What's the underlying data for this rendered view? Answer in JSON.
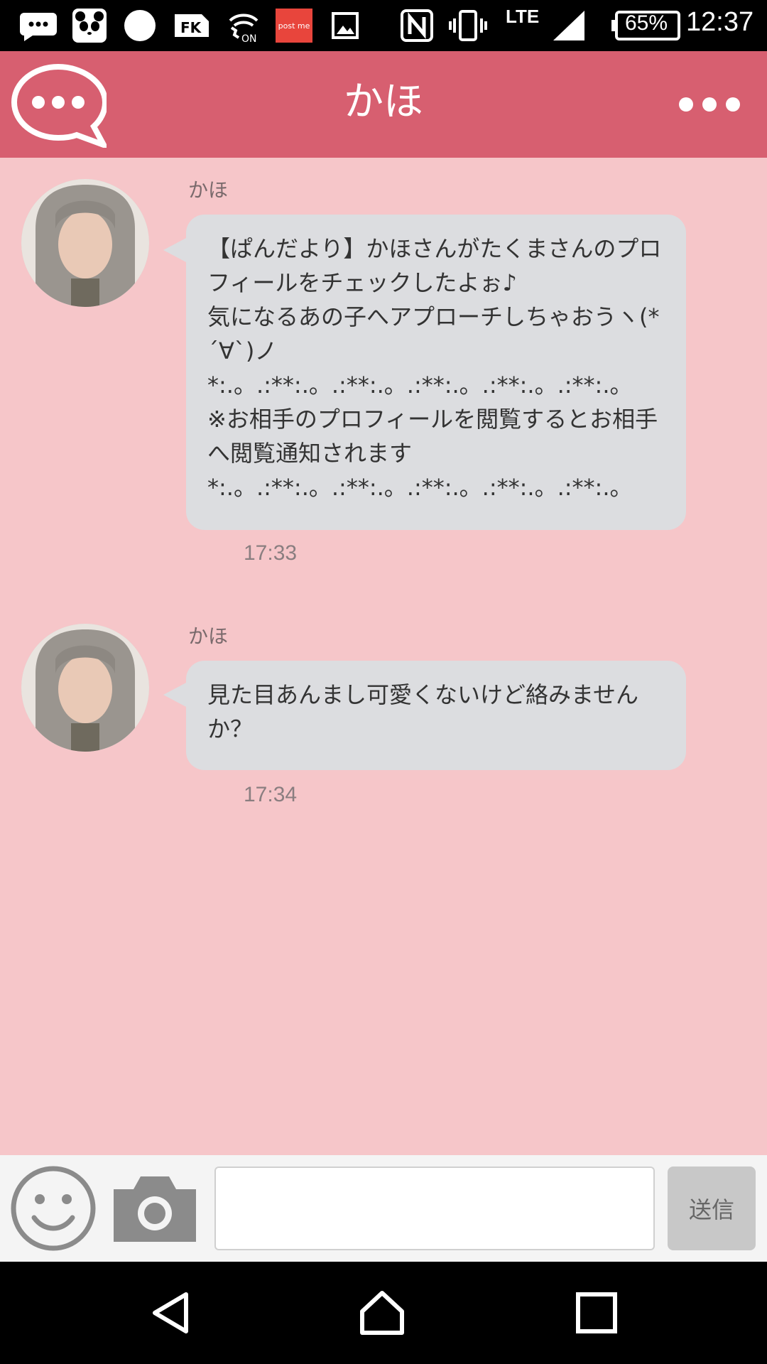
{
  "status_bar": {
    "battery": "65%",
    "time": "12:37",
    "network": "LTE",
    "postme_label": "post me",
    "wifi_label": "ON",
    "icons": [
      "chat-bubble-icon",
      "panda-icon",
      "circle-icon",
      "fk-icon",
      "wifi-calling-icon",
      "postme-icon",
      "image-icon",
      "nfc-icon",
      "vibrate-icon",
      "signal-icon",
      "battery-icon"
    ]
  },
  "header": {
    "title": "かほ",
    "left_icon": "chat-bubble-logo-icon",
    "right_icon": "more-options-icon"
  },
  "messages": [
    {
      "sender": "かほ",
      "text": "【ぱんだより】かほさんがたくまさんのプロフィールをチェックしたよぉ♪\n気になるあの子へアプローチしちゃおうヽ(*´∀`)ノ\n*:.。.:**:.。.:**:.。.:**:.。.:**:.。.:**:.。\n※お相手のプロフィールを閲覧するとお相手へ閲覧通知されます\n*:.。.:**:.。.:**:.。.:**:.。.:**:.。.:**:.。",
      "time": "17:33"
    },
    {
      "sender": "かほ",
      "text": "見た目あんまし可愛くないけど絡みませんか？",
      "time": "17:34"
    }
  ],
  "input_bar": {
    "emoji_icon": "smiley-icon",
    "camera_icon": "camera-icon",
    "message_value": "",
    "send_label": "送信"
  },
  "nav_bar": {
    "icons": [
      "back-icon",
      "home-icon",
      "recents-icon"
    ]
  },
  "colors": {
    "header_bg": "#d75f70",
    "chat_bg": "#f6c6c9",
    "bubble_bg": "#dcdde0"
  }
}
